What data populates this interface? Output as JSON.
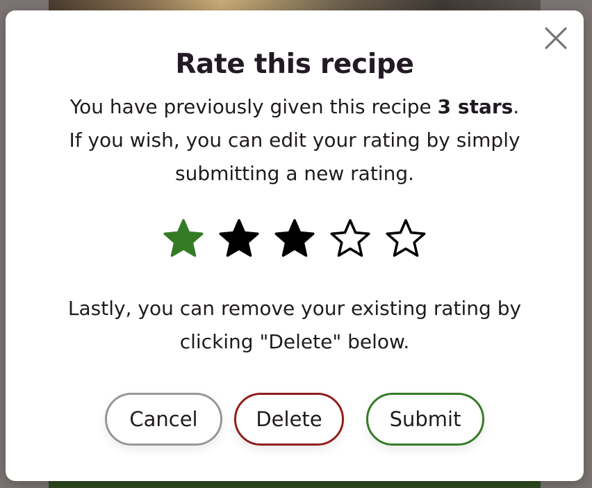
{
  "modal": {
    "title": "Rate this recipe",
    "intro_prefix": "You have previously given this recipe ",
    "intro_bold": "3 stars",
    "intro_suffix": ".",
    "intro_line2": "If you wish, you can edit your rating by simply submitting a new rating.",
    "remove_text": "Lastly, you can remove your existing rating by clicking \"Delete\" below.",
    "close_icon": "close-icon"
  },
  "rating": {
    "max_stars": 5,
    "previous_rating": 3,
    "selected_rating": 1,
    "colors": {
      "selected": "#357b26",
      "filled": "#000000",
      "empty_outline": "#000000"
    }
  },
  "buttons": {
    "cancel_label": "Cancel",
    "delete_label": "Delete",
    "submit_label": "Submit",
    "colors": {
      "cancel_border": "#9a9595",
      "delete_border": "#8f1f1c",
      "submit_border": "#357b26"
    }
  }
}
